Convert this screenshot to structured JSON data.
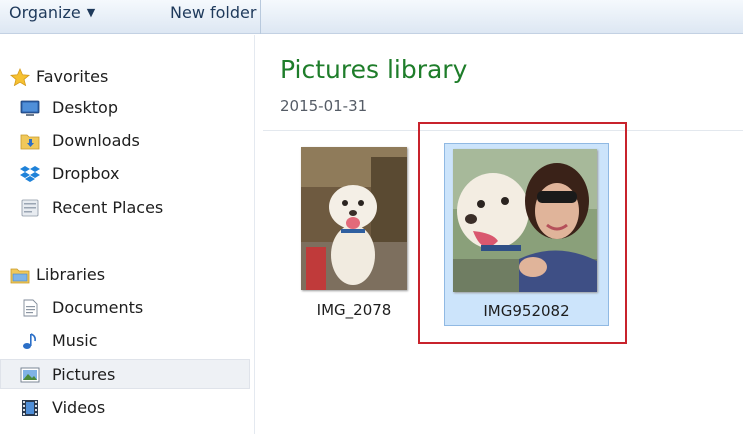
{
  "toolbar": {
    "organize_label": "Organize",
    "new_folder_label": "New folder"
  },
  "nav": {
    "favorites": {
      "label": "Favorites",
      "items": [
        {
          "label": "Desktop",
          "icon": "desktop-icon"
        },
        {
          "label": "Downloads",
          "icon": "downloads-folder-icon"
        },
        {
          "label": "Dropbox",
          "icon": "dropbox-icon"
        },
        {
          "label": "Recent Places",
          "icon": "recent-places-icon"
        }
      ]
    },
    "libraries": {
      "label": "Libraries",
      "items": [
        {
          "label": "Documents",
          "icon": "documents-icon"
        },
        {
          "label": "Music",
          "icon": "music-icon"
        },
        {
          "label": "Pictures",
          "icon": "pictures-icon",
          "selected": true
        },
        {
          "label": "Videos",
          "icon": "videos-icon"
        }
      ]
    }
  },
  "content": {
    "title": "Pictures library",
    "subtitle": "2015-01-31",
    "files": [
      {
        "name": "IMG_2078",
        "selected": false
      },
      {
        "name": "IMG952082",
        "selected": true
      }
    ]
  },
  "colors": {
    "title_green": "#1e7d2a",
    "selection_blue": "#cce4fb",
    "highlight_red": "#c8232c"
  }
}
